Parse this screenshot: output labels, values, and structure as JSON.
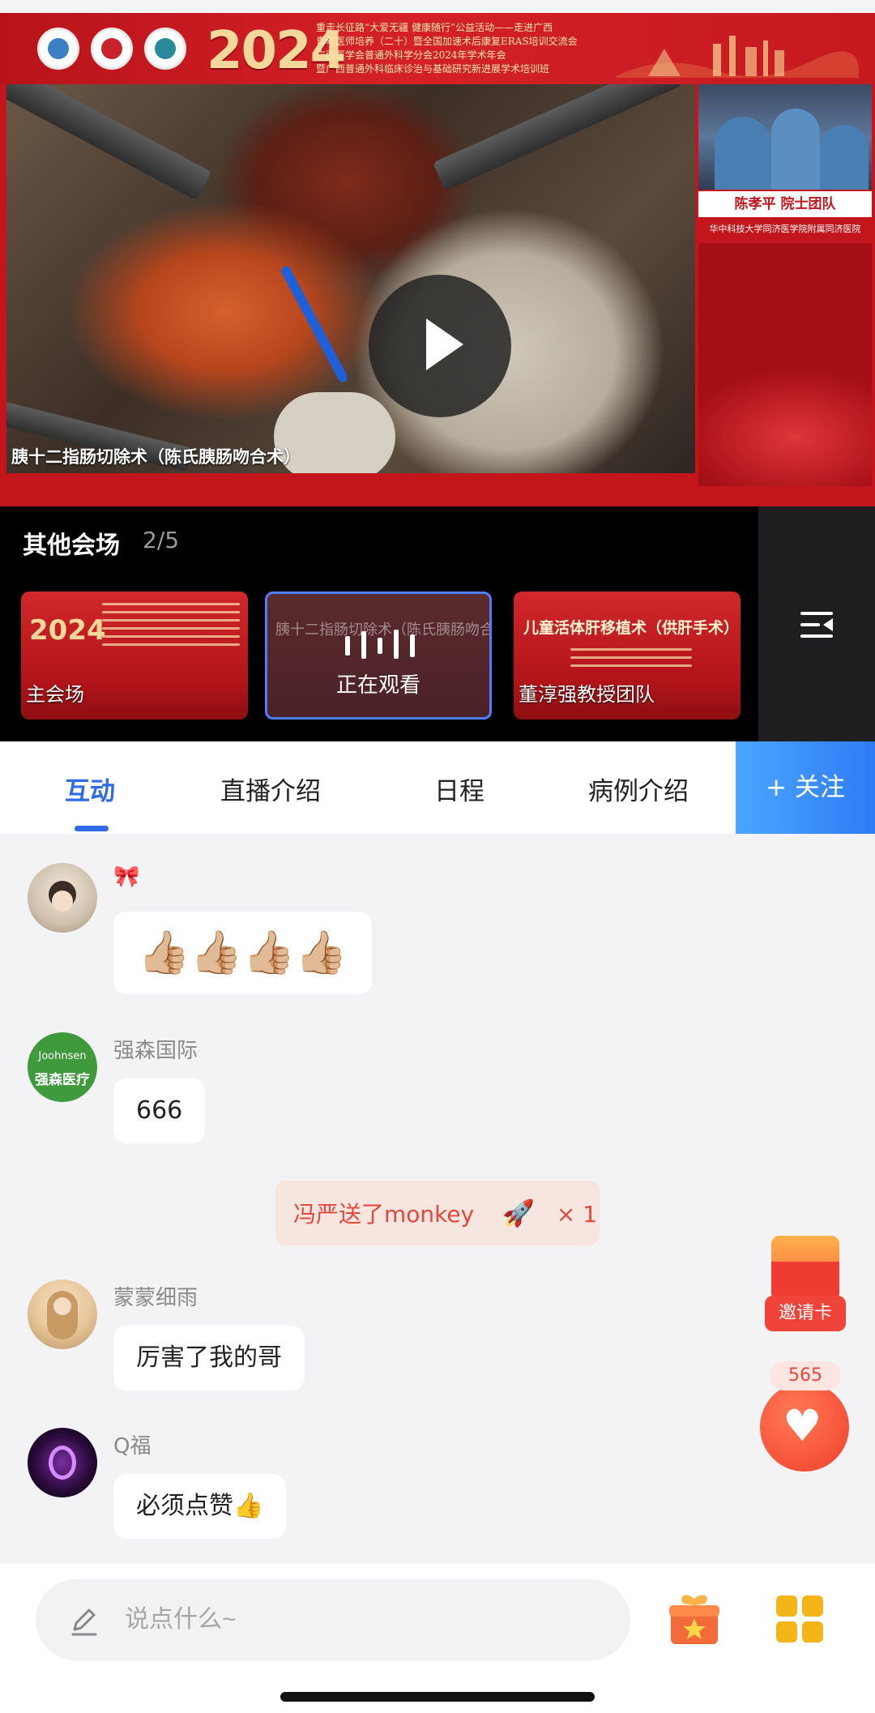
{
  "video": {
    "banner_year": "2024",
    "banner_lines": [
      "重走长征路“大爱无疆 健康随行”公益活动——走进广西",
      "青年医师培养（二十）暨全国加速术后康复ERAS培训交流会",
      "广西医学会普通外科学分会2024年学术年会",
      "暨广西普通外科临床诊治与基础研究新进展学术培训班"
    ],
    "caption": "胰十二指肠切除术（陈氏胰肠吻合术）",
    "side_team": "陈孝平 院士团队",
    "side_hospital": "华中科技大学同济医学院附属同济医院"
  },
  "venues": {
    "title": "其他会场",
    "count": "2/5",
    "cards": [
      {
        "label": "主会场",
        "year": "2024"
      },
      {
        "dim_title": "胰十二指肠切除术（陈氏胰肠吻合术）",
        "label": "正在观看"
      },
      {
        "title": "儿童活体肝移植术（供肝手术）",
        "label": "董淳强教授团队"
      }
    ]
  },
  "tabs": {
    "items": [
      "互动",
      "直播介绍",
      "日程",
      "病例介绍"
    ],
    "active": 0,
    "follow": "+ 关注"
  },
  "chat": {
    "messages": [
      {
        "user": "🎀",
        "text": "👍🏼👍🏼👍🏼👍🏼"
      },
      {
        "user": "强森国际",
        "text": "666",
        "avatar_text_top": "Joohnsen",
        "avatar_text_bottom": "强森医疗"
      },
      {
        "user": "蒙蒙细雨",
        "text": "厉害了我的哥"
      },
      {
        "user": "Q福",
        "text": "必须点赞👍"
      }
    ],
    "gift_notice": {
      "text": "冯严送了monkey",
      "icon": "🚀",
      "count": "× 1"
    }
  },
  "widgets": {
    "invite_label": "邀请卡",
    "like_count": "565",
    "heart_icon": "♥"
  },
  "input": {
    "placeholder": "说点什么~"
  },
  "colors": {
    "accent": "#2f6be6",
    "follow_button": "#3a8cf8",
    "brand_red": "#c3161c",
    "like": "#f2402c",
    "gift_text": "#e4483c"
  }
}
